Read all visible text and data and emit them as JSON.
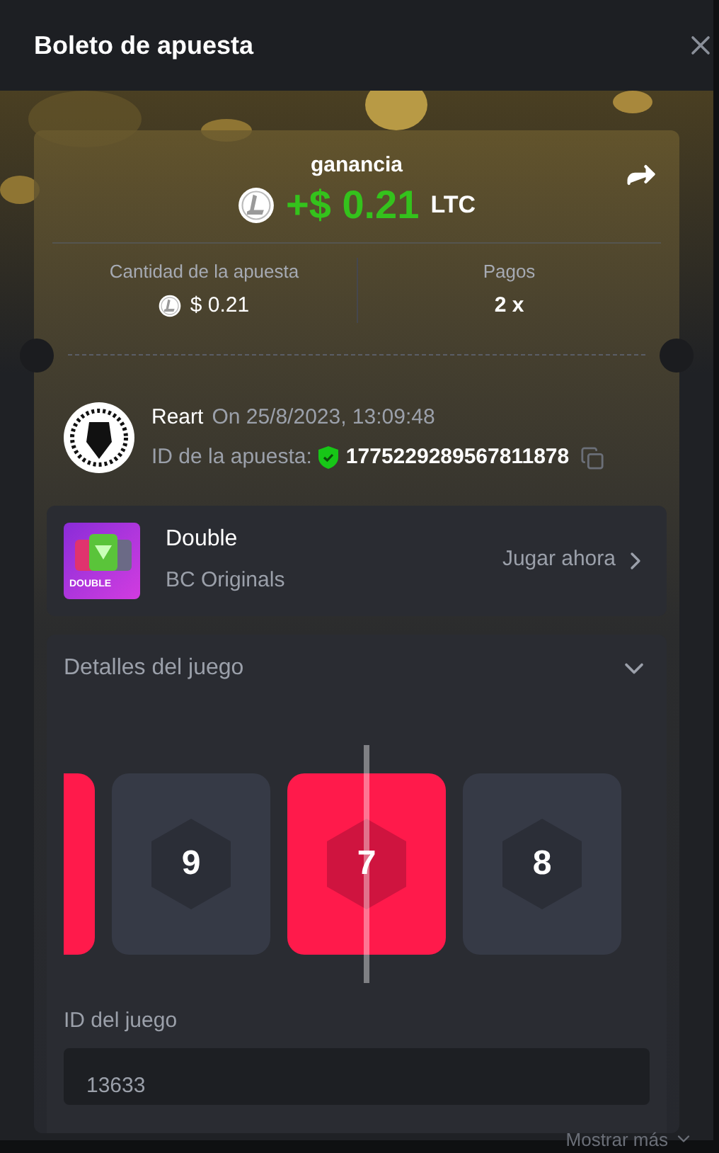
{
  "window": {
    "title": "Boleto de apuesta"
  },
  "result": {
    "label": "ganancia",
    "amount": "+$ 0.21",
    "currency": "LTC"
  },
  "stats": [
    {
      "label": "Cantidad de la apuesta",
      "value": "$ 0.21",
      "coin": true
    },
    {
      "label": "Pagos",
      "value": "2 x",
      "coin": false
    }
  ],
  "bet": {
    "user": "Reart",
    "date": "On 25/8/2023, 13:09:48",
    "id_label": "ID de la apuesta:",
    "id": "1775229289567811878",
    "verified": true
  },
  "game": {
    "title": "Double",
    "provider": "BC Originals",
    "thumb_label": "DOUBLE",
    "action": "Jugar ahora"
  },
  "details": {
    "title": "Detalles del juego",
    "expanded": true,
    "tiles": [
      {
        "kind": "red",
        "selected": false
      },
      {
        "kind": "gray",
        "label": "9",
        "selected": false
      },
      {
        "kind": "red",
        "label": "7",
        "selected": true
      },
      {
        "kind": "gray",
        "label": "8",
        "selected": false
      }
    ],
    "field_label": "ID del juego",
    "field_value": "13633"
  },
  "footer_link": "Mostrar más"
}
